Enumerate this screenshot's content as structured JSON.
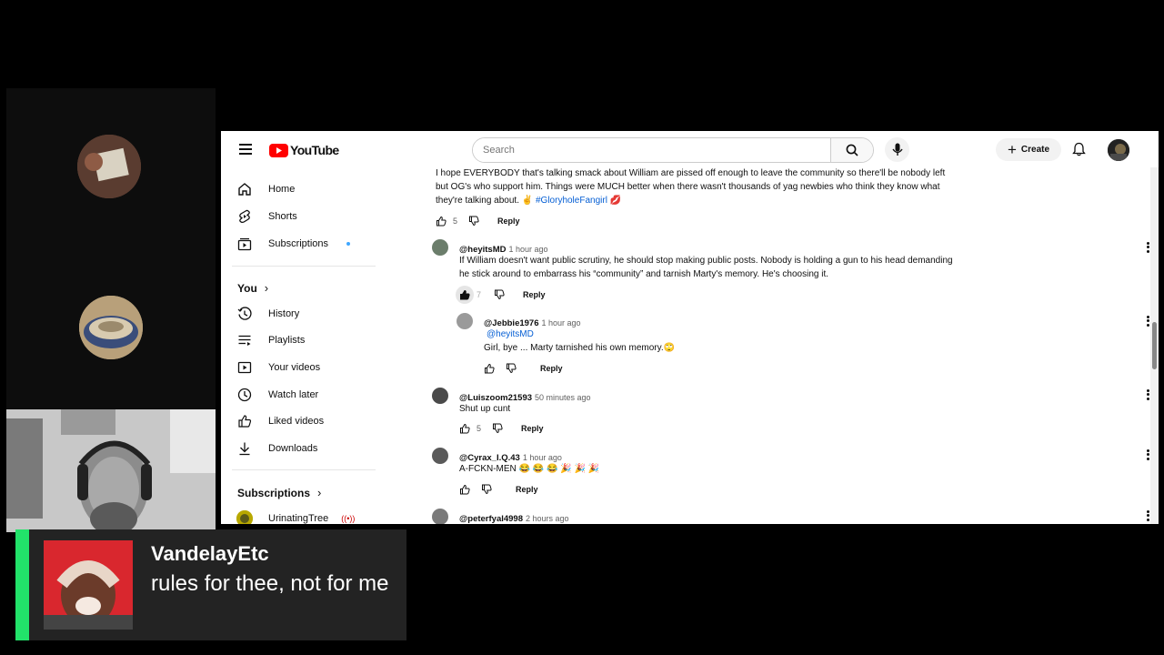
{
  "brand": {
    "logo_text": "YouTube",
    "accent": "#ff0000"
  },
  "search": {
    "placeholder": "Search"
  },
  "header": {
    "create_label": "Create"
  },
  "sidebar": {
    "items": [
      {
        "label": "Home",
        "icon": "home-icon"
      },
      {
        "label": "Shorts",
        "icon": "shorts-icon"
      },
      {
        "label": "Subscriptions",
        "icon": "subscriptions-icon"
      }
    ],
    "you_heading": "You",
    "you_items": [
      {
        "label": "History",
        "icon": "history-icon"
      },
      {
        "label": "Playlists",
        "icon": "playlists-icon"
      },
      {
        "label": "Your videos",
        "icon": "your-videos-icon"
      },
      {
        "label": "Watch later",
        "icon": "watch-later-icon"
      },
      {
        "label": "Liked videos",
        "icon": "liked-videos-icon"
      },
      {
        "label": "Downloads",
        "icon": "downloads-icon"
      }
    ],
    "subscriptions_heading": "Subscriptions",
    "channels": [
      {
        "label": "UrinatingTree",
        "live": true
      }
    ]
  },
  "comments": [
    {
      "text_lines": [
        "I hope EVERYBODY that's talking smack about William are pissed off enough to leave the community so there'll be nobody left",
        "but OG's who support him. Things were MUCH better when there wasn't thousands of yag newbies who think they know what",
        "they're talking about. ✌️"
      ],
      "hashtag": "#GloryholeFangirl",
      "emoji_end": "💋",
      "likes": "5",
      "reply_label": "Reply"
    },
    {
      "author": "@heyitsMD",
      "time": "1 hour ago",
      "text_lines": [
        "If William doesn't want public scrutiny, he should stop making public posts. Nobody is holding a gun to his head demanding",
        "he stick around to embarrass his “community” and tarnish Marty's memory. He's choosing it."
      ],
      "likes": "7",
      "reply_label": "Reply"
    },
    {
      "author": "@Jebbie1976",
      "time": "1 hour ago",
      "mention": "@heyitsMD",
      "text": "Girl, bye ... Marty tarnished his own memory.🙄",
      "reply_label": "Reply"
    },
    {
      "author": "@Luiszoom21593",
      "time": "50 minutes ago",
      "text": "Shut up cunt",
      "likes": "5",
      "reply_label": "Reply"
    },
    {
      "author": "@Cyrax_I.Q.43",
      "time": "1 hour ago",
      "text": "A-FCKN-MEN 😂 😂 😂 🎉 🎉 🎉",
      "reply_label": "Reply"
    },
    {
      "author": "@peterfyal4998",
      "time": "2 hours ago"
    }
  ],
  "overlay": {
    "username": "VandelayEtc",
    "message": "rules for thee, not for me",
    "accent": "#22e36a"
  }
}
